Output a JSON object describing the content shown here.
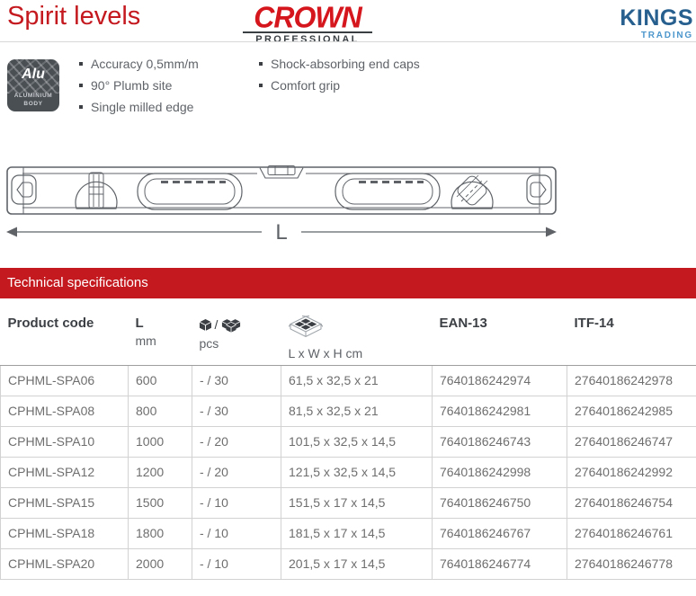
{
  "header": {
    "title": "Spirit levels",
    "brand": {
      "name": "CROWN",
      "subtitle": "PROFESSIONAL"
    },
    "vendor": {
      "name": "KINGS",
      "subtitle": "TRADING"
    }
  },
  "badge": {
    "label": "Alu",
    "caption1": "ALUMINIUM",
    "caption2": "BODY",
    "icon": "aluminium-body-badge"
  },
  "features": {
    "col1": [
      "Accuracy 0,5mm/m",
      "90° Plumb site",
      "Single milled edge"
    ],
    "col2": [
      "Shock-absorbing end caps",
      "Comfort grip"
    ]
  },
  "diagram": {
    "dimension_label": "L",
    "icon": "spirit-level-technical-drawing"
  },
  "section": {
    "title": "Technical specifications"
  },
  "table": {
    "headers": {
      "product_code": "Product code",
      "length": "L",
      "length_unit": "mm",
      "pcs_separator": "/",
      "pcs_label": "pcs",
      "box_label": "L x W x H cm",
      "ean": "EAN-13",
      "itf": "ITF-14"
    },
    "icons": {
      "pcs_single": "single-cube-icon",
      "pcs_multi": "cube-stack-icon",
      "box": "open-carton-icon"
    },
    "rows": [
      {
        "code": "CPHML-SPA06",
        "l": "600",
        "pcs": "- / 30",
        "box": "61,5 x 32,5 x 21",
        "ean": "7640186242974",
        "itf": "27640186242978"
      },
      {
        "code": "CPHML-SPA08",
        "l": "800",
        "pcs": "- / 30",
        "box": "81,5 x 32,5 x 21",
        "ean": "7640186242981",
        "itf": "27640186242985"
      },
      {
        "code": "CPHML-SPA10",
        "l": "1000",
        "pcs": "- / 20",
        "box": "101,5 x 32,5 x 14,5",
        "ean": "7640186246743",
        "itf": "27640186246747"
      },
      {
        "code": "CPHML-SPA12",
        "l": "1200",
        "pcs": "- / 20",
        "box": "121,5 x 32,5 x 14,5",
        "ean": "7640186242998",
        "itf": "27640186242992"
      },
      {
        "code": "CPHML-SPA15",
        "l": "1500",
        "pcs": "- / 10",
        "box": "151,5 x 17 x 14,5",
        "ean": "7640186246750",
        "itf": "27640186246754"
      },
      {
        "code": "CPHML-SPA18",
        "l": "1800",
        "pcs": "- / 10",
        "box": "181,5 x 17 x 14,5",
        "ean": "7640186246767",
        "itf": "27640186246761"
      },
      {
        "code": "CPHML-SPA20",
        "l": "2000",
        "pcs": "- / 10",
        "box": "201,5 x 17 x 14,5",
        "ean": "7640186246774",
        "itf": "27640186246778"
      }
    ]
  },
  "colors": {
    "accent_red": "#C4191F",
    "brand_red": "#D5161D",
    "kings_navy": "#27608F",
    "kings_blue": "#4C96CC",
    "badge_bg": "#4A4F54",
    "text_gray": "#6E6E6E",
    "head_text": "#3C4045",
    "border": "#D2D2D2"
  }
}
